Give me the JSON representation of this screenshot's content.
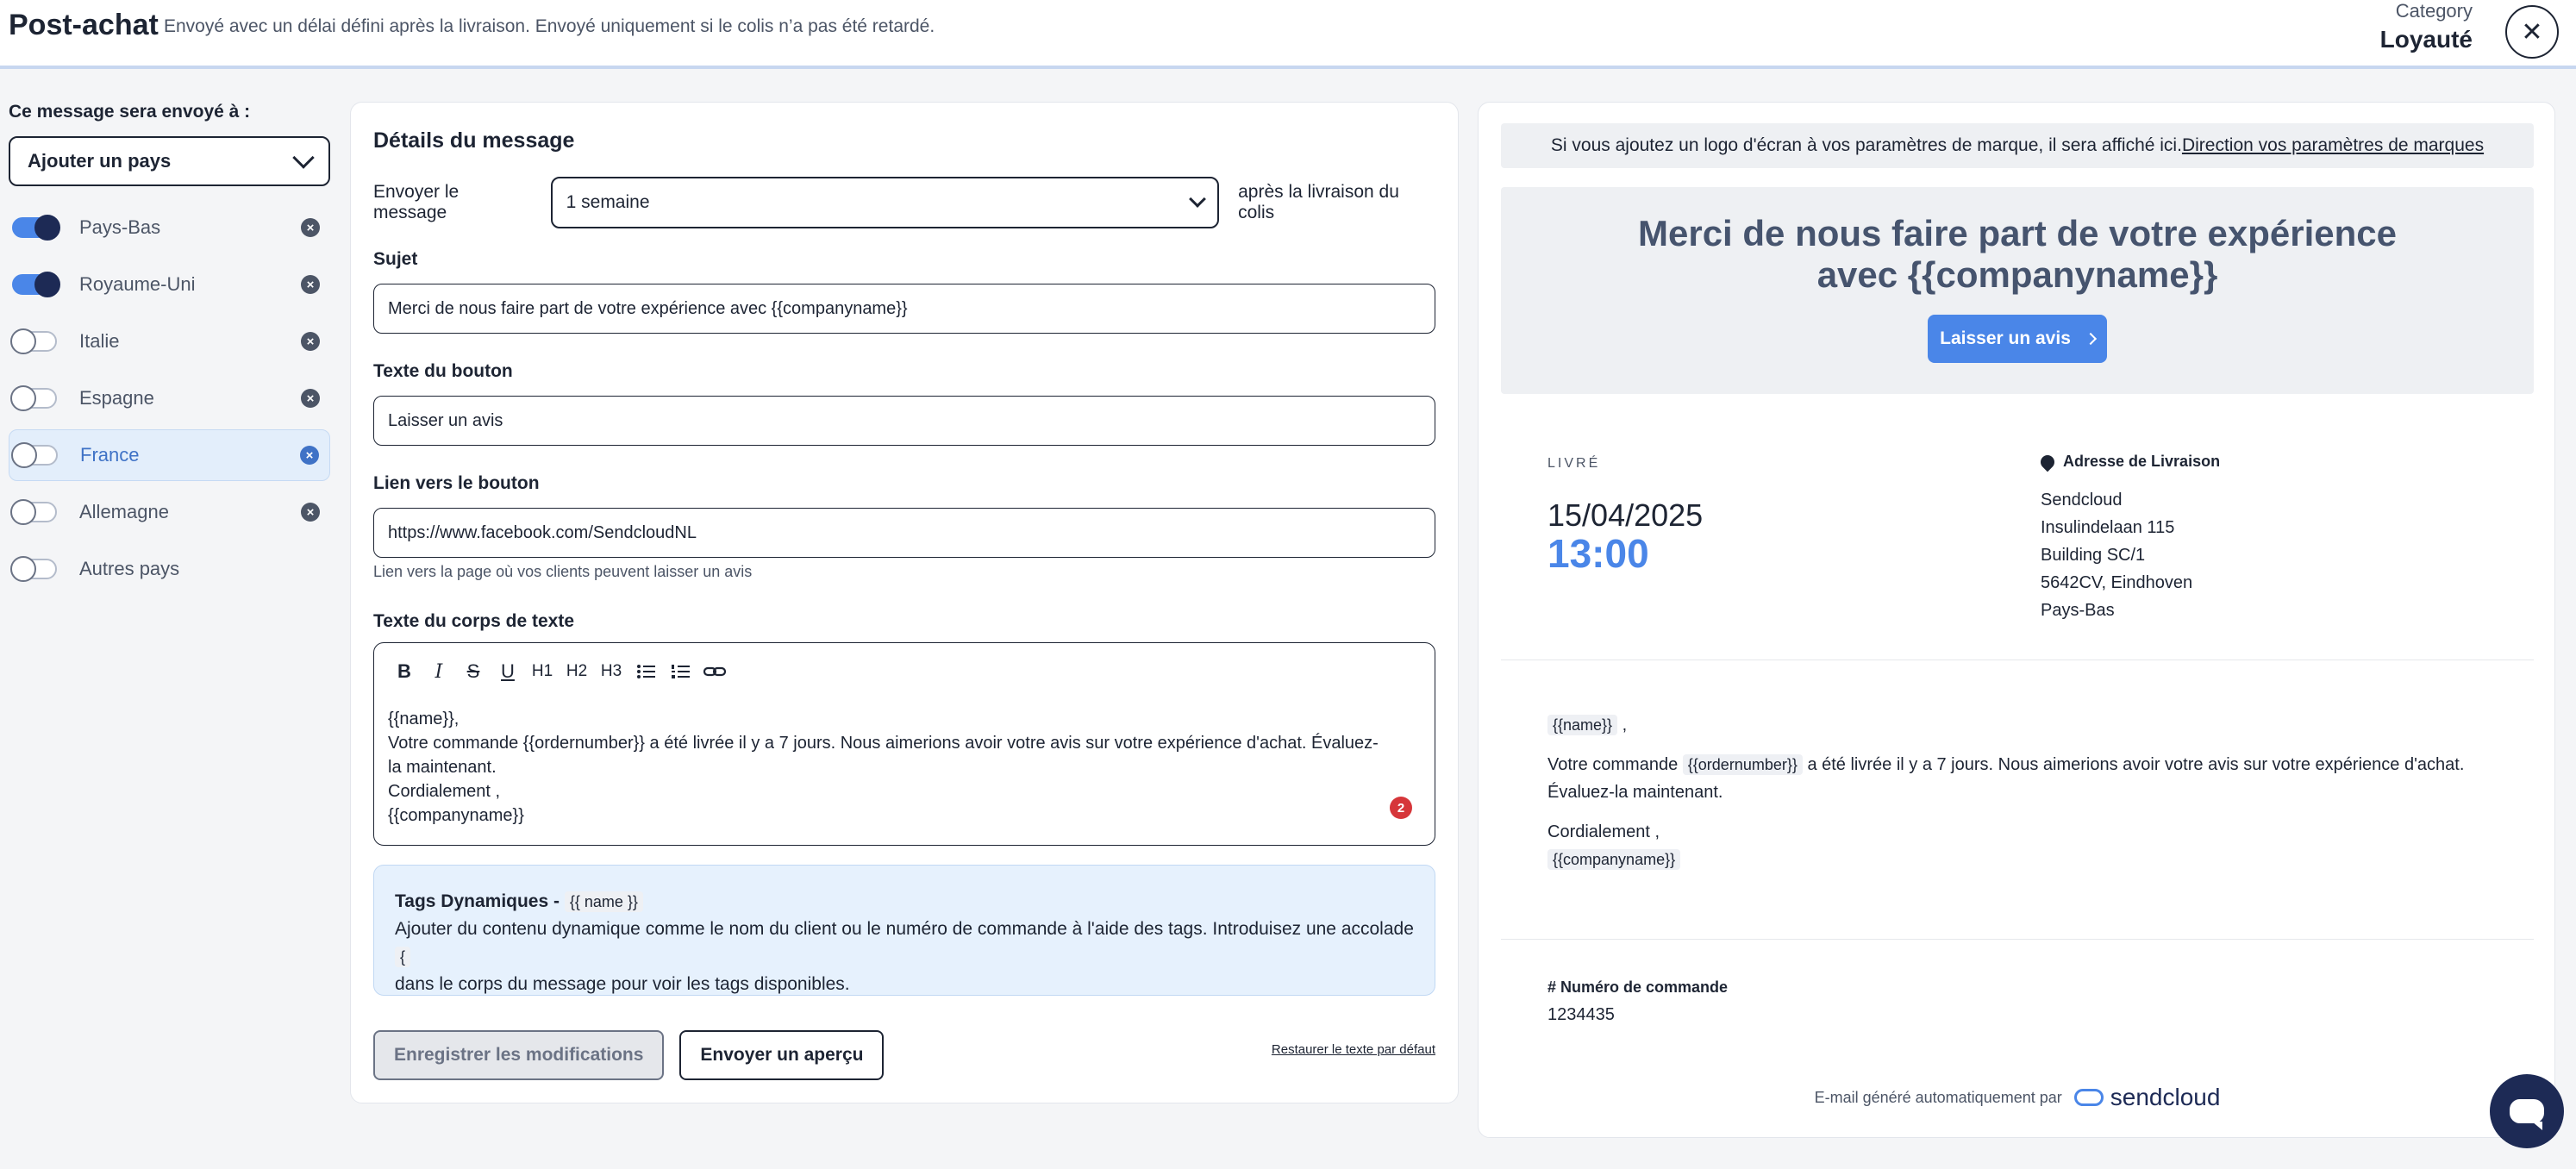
{
  "header": {
    "title": "Post-achat",
    "subtitle": "Envoyé avec un délai défini après la livraison. Envoyé uniquement si le colis n’a pas été retardé.",
    "category_label": "Category",
    "category_value": "Loyauté",
    "close_glyph": "✕"
  },
  "countries": {
    "label": "Ce message sera envoyé à :",
    "add_label": "Ajouter un pays",
    "items": [
      {
        "name": "Pays-Bas",
        "enabled": true,
        "removable": true
      },
      {
        "name": "Royaume-Uni",
        "enabled": true,
        "removable": true
      },
      {
        "name": "Italie",
        "enabled": false,
        "removable": true
      },
      {
        "name": "Espagne",
        "enabled": false,
        "removable": true
      },
      {
        "name": "France",
        "enabled": false,
        "removable": true,
        "selected": true
      },
      {
        "name": "Allemagne",
        "enabled": false,
        "removable": true
      },
      {
        "name": "Autres pays",
        "enabled": false,
        "removable": false
      }
    ]
  },
  "form": {
    "section_title": "Détails du message",
    "send_label": "Envoyer le message",
    "send_value": "1 semaine",
    "send_after": "après la livraison du colis",
    "subject_label": "Sujet",
    "subject_value": "Merci de nous faire part de votre expérience avec {{companyname}}",
    "button_text_label": "Texte du bouton",
    "button_text_value": "Laisser un avis",
    "button_link_label": "Lien vers le bouton",
    "button_link_value": "https://www.facebook.com/SendcloudNL",
    "button_link_hint": "Lien vers la page où vos clients peuvent laisser un avis",
    "body_label": "Texte du corps de texte",
    "toolbar": {
      "h1": "H1",
      "h2": "H2",
      "h3": "H3",
      "bold": "B",
      "italic": "I",
      "strike": "S",
      "underline": "U"
    },
    "body_lines": [
      "{{name}},",
      "Votre commande {{ordernumber}} a été livrée il y a 7 jours. Nous aimerions avoir votre avis sur votre expérience d'achat. Évaluez-la maintenant.",
      "Cordialement ,",
      "{{companyname}}"
    ],
    "error_count": "2",
    "tags_title": "Tags Dynamiques -",
    "tags_example": "{{ name }}",
    "tags_text": "Ajouter du contenu dynamique comme le nom du client ou le numéro de commande à l'aide des tags. Introduisez une accolade",
    "tags_brace": "{",
    "tags_text2": "dans le corps du message pour voir les tags disponibles.",
    "save_label": "Enregistrer les modifications",
    "preview_label": "Envoyer un aperçu",
    "restore_label": "Restaurer le texte par défaut"
  },
  "preview": {
    "logo_note": "Si vous ajoutez un logo d'écran à vos paramètres de marque, il sera affiché ici.",
    "logo_link": "Direction vos paramètres de marques",
    "hero_title": "Merci de nous faire part de votre expérience avec {{companyname}}",
    "cta_label": "Laisser un avis",
    "delivered_label": "LIVRÉ",
    "delivered_date": "15/04/2025",
    "delivered_time": "13:00",
    "address_title": "Adresse de Livraison",
    "address_lines": [
      "Sendcloud",
      "Insulindelaan 115",
      "Building SC/1",
      "5642CV, Eindhoven",
      "Pays-Bas"
    ],
    "msg_name": "{{name}}",
    "msg_comma": ",",
    "msg_prefix": "Votre commande",
    "msg_ordernumber": "{{ordernumber}}",
    "msg_suffix": "a été livrée il y a 7 jours. Nous aimerions avoir votre avis sur votre expérience d'achat. Évaluez-la maintenant.",
    "msg_regards": "Cordialement ,",
    "msg_company": "{{companyname}}",
    "order_label": "# Numéro de commande",
    "order_value": "1234435",
    "footer_text": "E-mail généré automatiquement par",
    "brand": "sendcloud"
  },
  "colors": {
    "accent": "#4a86e8",
    "navy": "#1d2a55",
    "error": "#d6363a"
  }
}
